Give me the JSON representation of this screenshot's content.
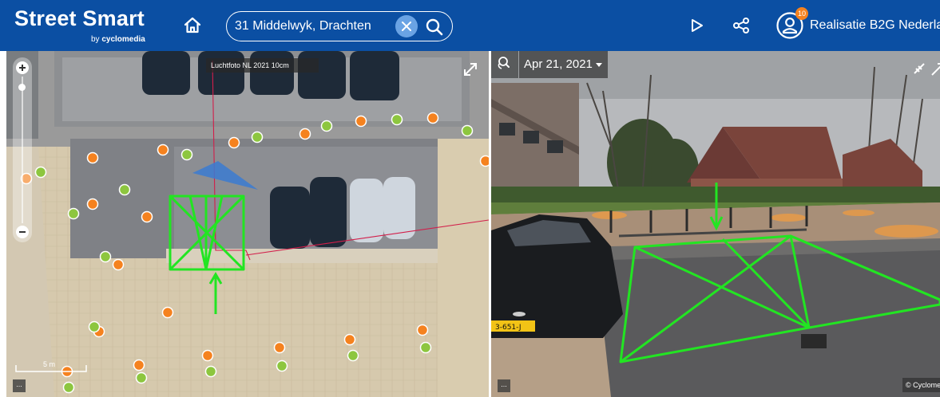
{
  "header": {
    "logo_title": "Street Smart",
    "logo_by": "by ",
    "logo_brand": "cyclomedia",
    "search_value": "31 Middelwyk, Drachten",
    "user_name": "Realisatie B2G Nederla",
    "notification_count": "10",
    "icons": [
      "home-icon",
      "close-icon",
      "search-icon",
      "play-icon",
      "share-icon",
      "user-icon"
    ],
    "brand_color": "#0b4fa3"
  },
  "map": {
    "layer_label": "Luchtfoto NL 2021 10cm",
    "scale_label": "5 m",
    "more_label": "...",
    "marker_colors": {
      "orange": "#f5821f",
      "green": "#8dc63f"
    },
    "overlay_color": "#22e522"
  },
  "pano": {
    "date": "Apr 21, 2021",
    "copyright": "© Cyclomedia",
    "more_label": "...",
    "plate": "3-651-J"
  }
}
